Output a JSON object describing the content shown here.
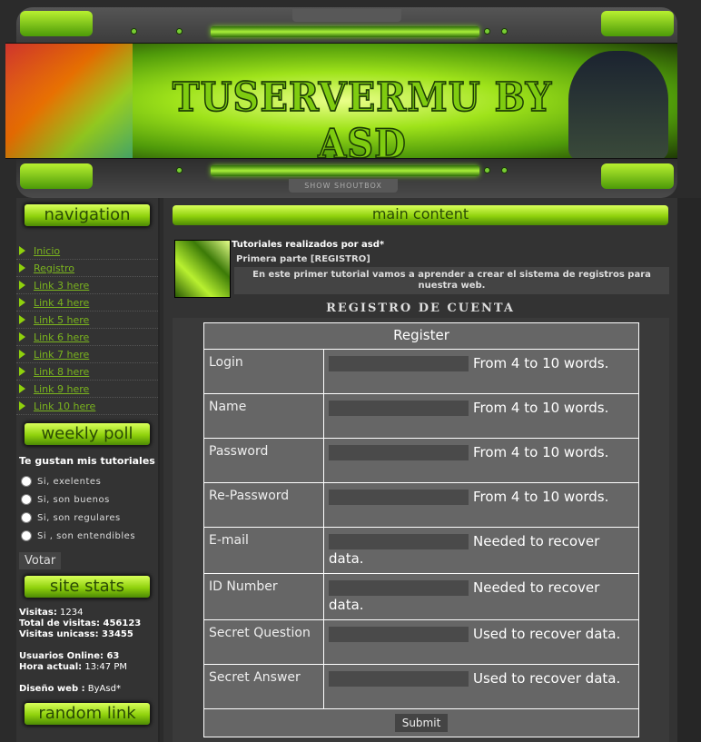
{
  "header": {
    "title": "TUSERVERMU BY ASD",
    "shoutbox_label": "SHOW SHOUTBOX",
    "accent": "#8fd10c"
  },
  "sidebar": {
    "navigation_title": "navigation",
    "nav": [
      {
        "label": "Inicio"
      },
      {
        "label": "Registro"
      },
      {
        "label": "Link 3 here"
      },
      {
        "label": "Link 4 here"
      },
      {
        "label": "Link 5 here"
      },
      {
        "label": "Link 6 here"
      },
      {
        "label": "Link 7 here"
      },
      {
        "label": "Link 8 here"
      },
      {
        "label": "Link 9 here"
      },
      {
        "label": "Link 10 here"
      }
    ],
    "poll_title": "weekly poll",
    "poll_question": "Te gustan mis tutoriales",
    "poll_options": [
      "Si, exelentes",
      "Si, son buenos",
      "Si, son regulares",
      "Si , son entendibles"
    ],
    "vote_label": "Votar",
    "stats_title": "site stats",
    "stats": [
      {
        "k": "Visitas:",
        "v": " 1234"
      },
      {
        "k": "Total de visitas:",
        "v": " 456123"
      },
      {
        "k": "Visitas unicass:",
        "v": " 33455"
      },
      {
        "k": "Usuarios Online:",
        "v": " 63"
      },
      {
        "k": "Hora actual:",
        "v": " 13:47 PM"
      },
      {
        "k": "Diseño web :",
        "v": " ByAsd*"
      }
    ],
    "random_title": "random link"
  },
  "main": {
    "title": "main content",
    "post_title": "Tutoriales realizados por asd*",
    "post_subtitle": "Primera parte [REGISTRO]",
    "post_desc": "En este primer tutorial vamos a aprender a crear el sistema de registros para nuestra web.",
    "section_title": "REGISTRO DE CUENTA",
    "form": {
      "header": "Register",
      "rows": [
        {
          "label": "Login",
          "hint": "From 4 to 10 words."
        },
        {
          "label": "Name",
          "hint": "From 4 to 10 words."
        },
        {
          "label": "Password",
          "hint": "From 4 to 10 words."
        },
        {
          "label": "Re-Password",
          "hint": "From 4 to 10 words."
        },
        {
          "label": "E-mail",
          "hint": "Needed to recover data."
        },
        {
          "label": "ID Number",
          "hint": "Needed to recover data."
        },
        {
          "label": "Secret Question",
          "hint": "Used to recover data."
        },
        {
          "label": "Secret Answer",
          "hint": "Used to recover data."
        }
      ],
      "submit_label": "Submit"
    }
  }
}
